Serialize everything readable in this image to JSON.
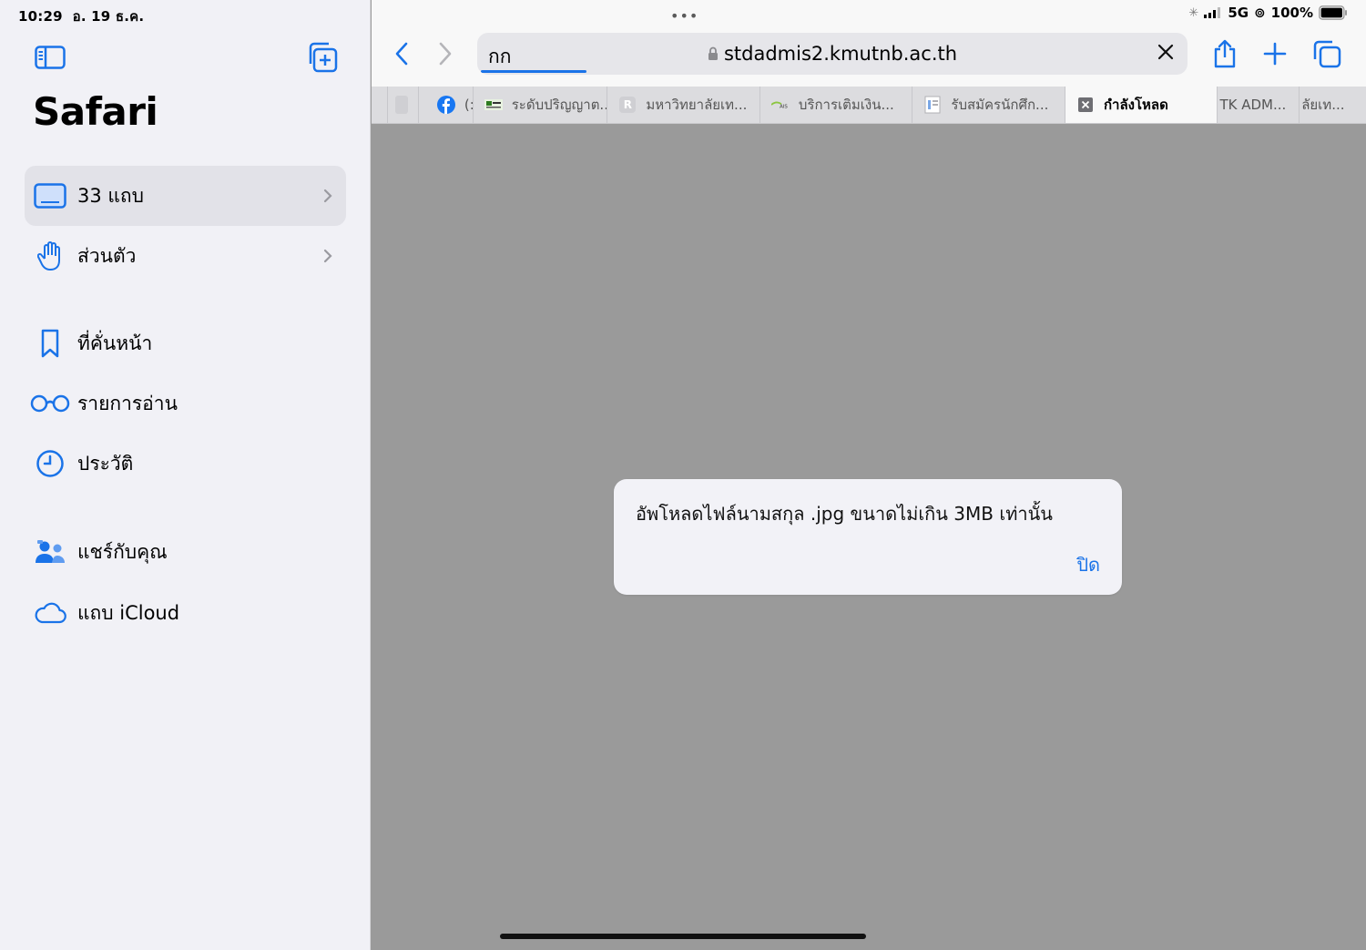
{
  "status": {
    "time": "10:29",
    "date": "อ. 19 ธ.ค.",
    "network": "5G",
    "battery": "100%"
  },
  "sidebar": {
    "title": "Safari",
    "primary": [
      {
        "label": "33 แถบ",
        "icon": "tabs-icon"
      },
      {
        "label": "ส่วนตัว",
        "icon": "hand-icon"
      }
    ],
    "items": [
      {
        "label": "ที่คั่นหน้า",
        "icon": "bookmark-icon"
      },
      {
        "label": "รายการอ่าน",
        "icon": "glasses-icon"
      },
      {
        "label": "ประวัติ",
        "icon": "clock-icon"
      }
    ],
    "shared": [
      {
        "label": "แชร์กับคุณ",
        "icon": "people-icon"
      },
      {
        "label": "แถบ iCloud",
        "icon": "cloud-icon"
      }
    ]
  },
  "toolbar": {
    "reader_label": "กก",
    "url": "stdadmis2.kmutnb.ac.th"
  },
  "tabs": [
    {
      "label": "(:",
      "icon": "facebook-icon"
    },
    {
      "label": "ระดับปริญญาต...",
      "icon": "site-favicon"
    },
    {
      "label": "มหาวิทยาลัยเท...",
      "icon": "letter-r-icon"
    },
    {
      "label": "บริการเติมเงิน...",
      "icon": "ais-icon"
    },
    {
      "label": "รับสมัครนักศึก...",
      "icon": "document-icon"
    },
    {
      "label": "กำลังโหลด",
      "icon": "close-box-icon"
    },
    {
      "label": "TK ADM...",
      "icon": ""
    },
    {
      "label": "ลัยเท...",
      "icon": ""
    }
  ],
  "alert": {
    "message": "อัพโหลดไฟล์นามสกุล .jpg ขนาดไม่เกิน 3MB เท่านั้น",
    "button": "ปิด"
  },
  "colors": {
    "accent": "#1a73e8",
    "sidebar_bg": "#f1f1f6",
    "content_bg": "#9a9a9a"
  }
}
